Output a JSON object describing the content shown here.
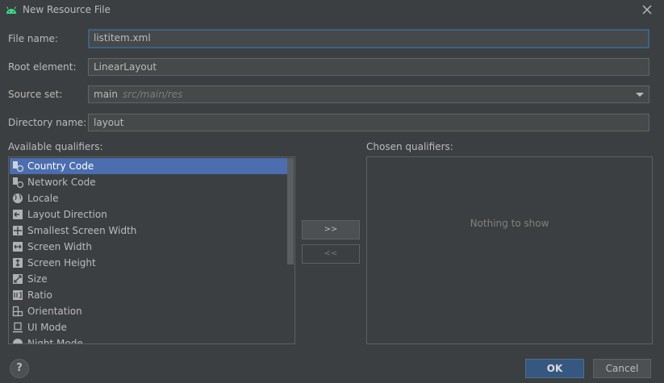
{
  "window": {
    "title": "New Resource File"
  },
  "form": {
    "file_name_label": "File name:",
    "file_name_value": "listitem.xml",
    "root_element_label": "Root element:",
    "root_element_value": "LinearLayout",
    "source_set_label": "Source set:",
    "source_set_value": "main",
    "source_set_hint": "src/main/res",
    "directory_label": "Directory name:",
    "directory_value": "layout"
  },
  "qualifiers": {
    "available_label": "Available qualifiers:",
    "chosen_label": "Chosen qualifiers:",
    "empty_text": "Nothing to show",
    "items": [
      {
        "label": "Country Code",
        "icon": "country-code-icon"
      },
      {
        "label": "Network Code",
        "icon": "network-code-icon"
      },
      {
        "label": "Locale",
        "icon": "globe-icon"
      },
      {
        "label": "Layout Direction",
        "icon": "layout-direction-icon"
      },
      {
        "label": "Smallest Screen Width",
        "icon": "smallest-width-icon"
      },
      {
        "label": "Screen Width",
        "icon": "screen-width-icon"
      },
      {
        "label": "Screen Height",
        "icon": "screen-height-icon"
      },
      {
        "label": "Size",
        "icon": "size-icon"
      },
      {
        "label": "Ratio",
        "icon": "ratio-icon"
      },
      {
        "label": "Orientation",
        "icon": "orientation-icon"
      },
      {
        "label": "UI Mode",
        "icon": "ui-mode-icon"
      },
      {
        "label": "Night Mode",
        "icon": "night-mode-icon"
      }
    ],
    "add_label": ">>",
    "remove_label": "<<"
  },
  "buttons": {
    "help": "?",
    "ok": "OK",
    "cancel": "Cancel"
  },
  "colors": {
    "accent": "#4b6eaf",
    "ok": "#365880",
    "background": "#3c3f41",
    "android": "#3ddc84"
  }
}
